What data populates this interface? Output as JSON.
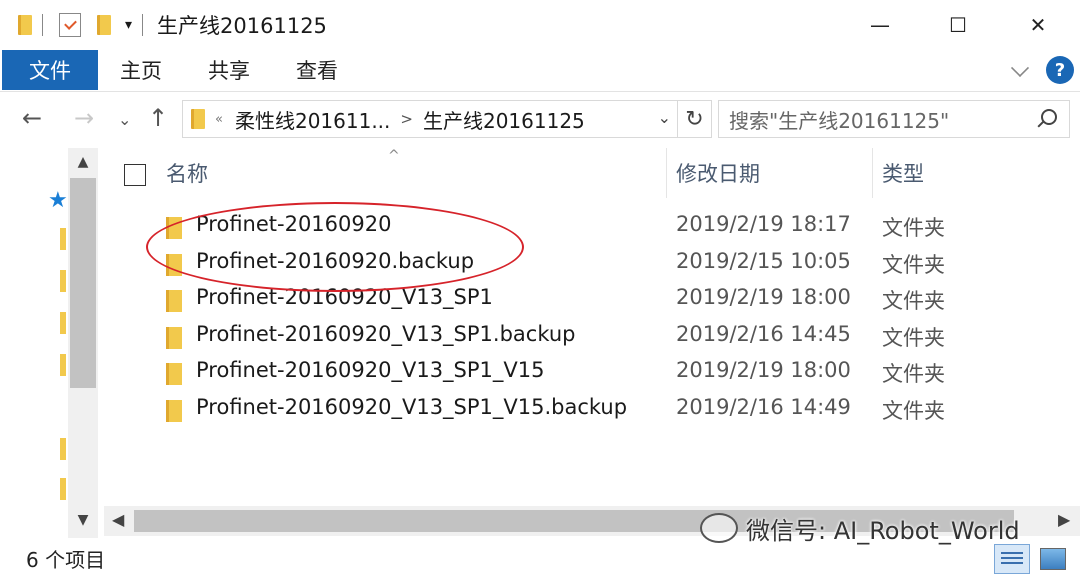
{
  "window": {
    "title": "生产线20161125",
    "minimize": "—",
    "maximize": "☐",
    "close": "✕"
  },
  "ribbon": {
    "tabs": [
      "文件",
      "主页",
      "共享",
      "查看"
    ],
    "help": "?"
  },
  "address": {
    "breadcrumb_parent": "柔性线201611...",
    "breadcrumb_current": "生产线20161125",
    "search_placeholder": "搜索\"生产线20161125\""
  },
  "columns": {
    "name": "名称",
    "date": "修改日期",
    "type": "类型"
  },
  "files": [
    {
      "name": "Profinet-20160920",
      "date": "2019/2/19 18:17",
      "type": "文件夹"
    },
    {
      "name": "Profinet-20160920.backup",
      "date": "2019/2/15 10:05",
      "type": "文件夹"
    },
    {
      "name": "Profinet-20160920_V13_SP1",
      "date": "2019/2/19 18:00",
      "type": "文件夹"
    },
    {
      "name": "Profinet-20160920_V13_SP1.backup",
      "date": "2019/2/16 14:45",
      "type": "文件夹"
    },
    {
      "name": "Profinet-20160920_V13_SP1_V15",
      "date": "2019/2/19 18:00",
      "type": "文件夹"
    },
    {
      "name": "Profinet-20160920_V13_SP1_V15.backup",
      "date": "2019/2/16 14:49",
      "type": "文件夹"
    }
  ],
  "status": {
    "item_count": "6 个项目"
  },
  "watermark": {
    "text": "微信号: AI_Robot_World"
  },
  "colors": {
    "accent": "#1a67b5",
    "annotation": "#d6232a",
    "folder": "#f2c94c"
  }
}
